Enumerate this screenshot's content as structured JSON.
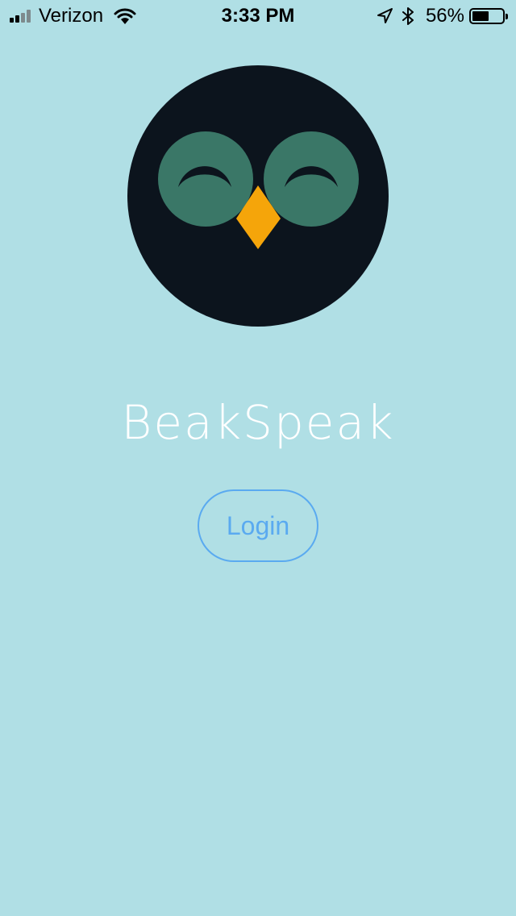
{
  "status_bar": {
    "carrier": "Verizon",
    "time": "3:33 PM",
    "battery_percent_label": "56%",
    "battery_level": 0.56,
    "signal_bars_filled": 2,
    "signal_bars_total": 4,
    "icons": [
      "signal-icon",
      "wifi-icon",
      "location-arrow-icon",
      "bluetooth-icon",
      "battery-icon"
    ]
  },
  "app": {
    "title": "BeakSpeak",
    "logo": "owl-logo"
  },
  "login": {
    "label": "Login"
  },
  "colors": {
    "background": "#b0dfe5",
    "owl_body": "#0c141d",
    "owl_eye": "#3a7767",
    "owl_beak": "#f5a50a",
    "title_text": "#ffffff",
    "button_accent": "#5aaaf0"
  }
}
